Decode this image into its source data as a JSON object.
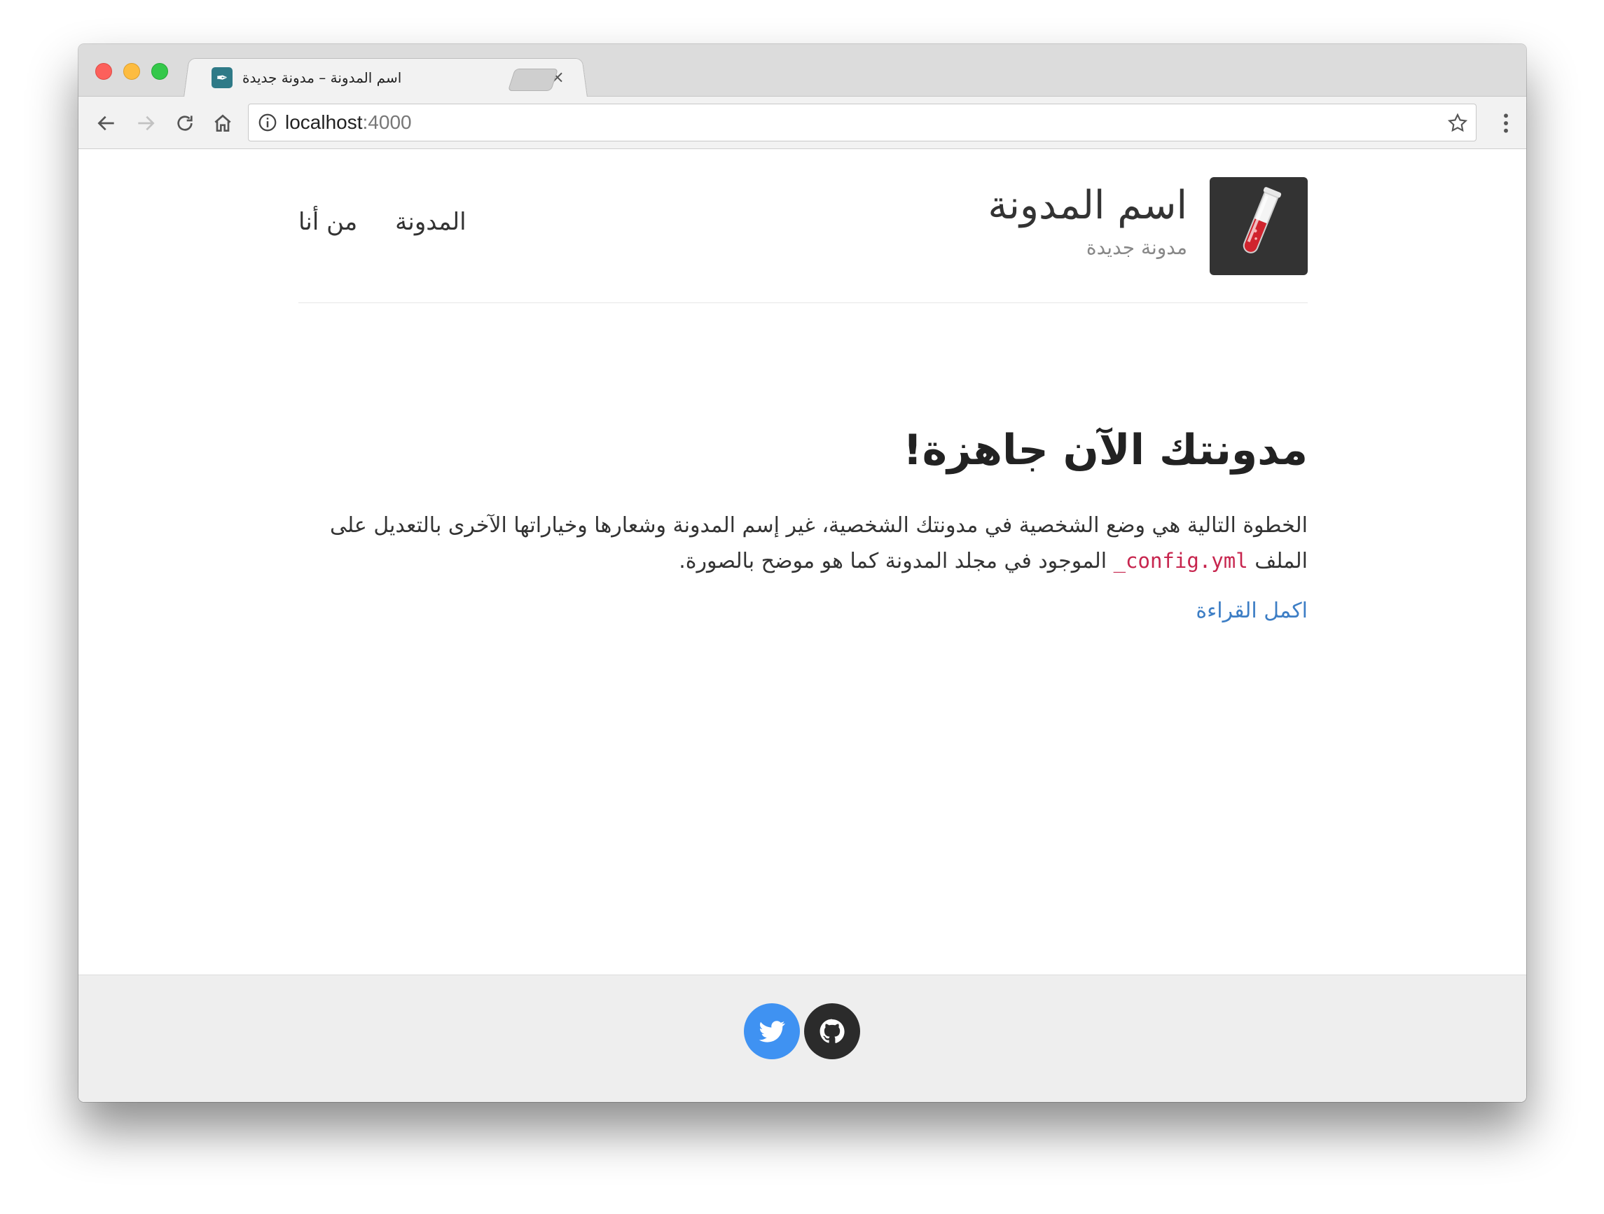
{
  "browser": {
    "tab": {
      "title": "اسم المدونة – مدونة جديدة",
      "close_glyph": "×",
      "favicon": "feather-icon"
    },
    "address": {
      "host": "localhost",
      "port": ":4000"
    }
  },
  "site": {
    "title": "اسم المدونة",
    "description": "مدونة جديدة",
    "logo": "test-tube-icon",
    "nav": {
      "blog": "المدونة",
      "about": "من أنا"
    }
  },
  "post": {
    "title": "مدونتك الآن جاهزة!",
    "body_before_code": "الخطوة التالية هي وضع الشخصية في مدونتك الشخصية، غير إسم المدونة وشعارها وخياراتها الآخرى بالتعديل على الملف ",
    "code": "_config.yml",
    "body_after_code": " الموجود في مجلد المدونة كما هو موضح بالصورة.",
    "read_more": "اكمل القراءة"
  },
  "footer": {
    "icons": [
      "twitter-icon",
      "github-icon"
    ]
  },
  "colors": {
    "link": "#3d7ec5",
    "code": "#c7254e",
    "twitter": "#3f92f2",
    "github": "#2b2b2b",
    "footer_bg": "#eeeeee"
  }
}
